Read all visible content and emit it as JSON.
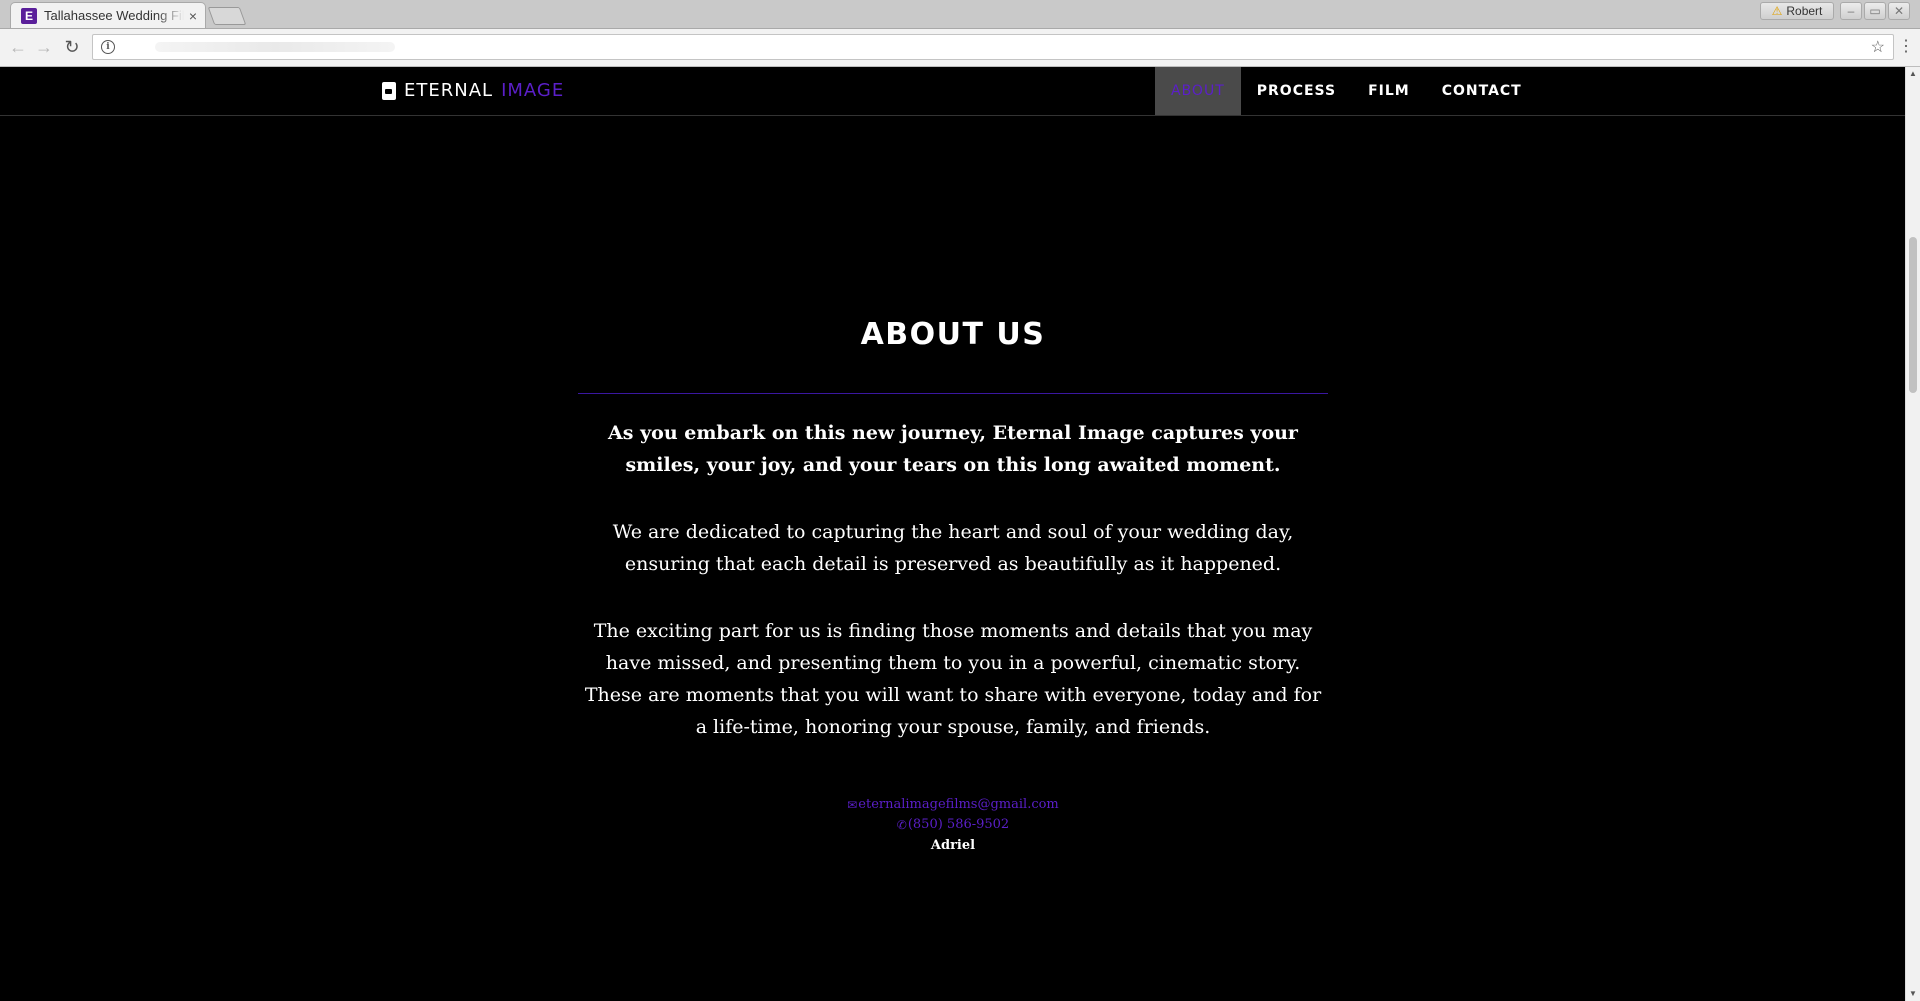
{
  "browser": {
    "tab_title": "Tallahassee Wedding Films",
    "tab_favicon": "eternal-image-favicon",
    "tab_close": "×",
    "profile_name": "Robert",
    "profile_warning_icon": "⚠",
    "window_controls": [
      "–",
      "▭",
      "✕"
    ],
    "back_icon": "←",
    "forward_icon": "→",
    "reload_icon": "↻",
    "info_icon": "i",
    "bookmark_icon": "☆",
    "menu_icon": "⋮"
  },
  "site": {
    "brand_main": "ETERNAL",
    "brand_accent": "IMAGE",
    "accent_color": "#5b1fc9",
    "nav": [
      {
        "label": "ABOUT",
        "active": true
      },
      {
        "label": "PROCESS",
        "active": false
      },
      {
        "label": "FILM",
        "active": false
      },
      {
        "label": "CONTACT",
        "active": false
      }
    ]
  },
  "about": {
    "title": "ABOUT US",
    "lead": "As you embark on this new journey, Eternal Image captures your smiles, your joy, and your tears on this long awaited moment.",
    "paragraphs": [
      "We are dedicated to capturing the heart and soul of your wedding day, ensuring that each detail is preserved as beautifully as it happened.",
      "The exciting part for us is finding those moments and details that you may have missed, and presenting them to you in a powerful, cinematic story. These are moments that you will want to share with everyone, today and for a life-time, honoring your spouse, family, and friends."
    ],
    "email_icon": "✉",
    "email": "eternalimagefilms@gmail.com",
    "phone_icon": "✆",
    "phone": "(850) 586-9502",
    "name": "Adriel"
  },
  "scrollbar": {
    "up_icon": "▲",
    "down_icon": "▼"
  }
}
